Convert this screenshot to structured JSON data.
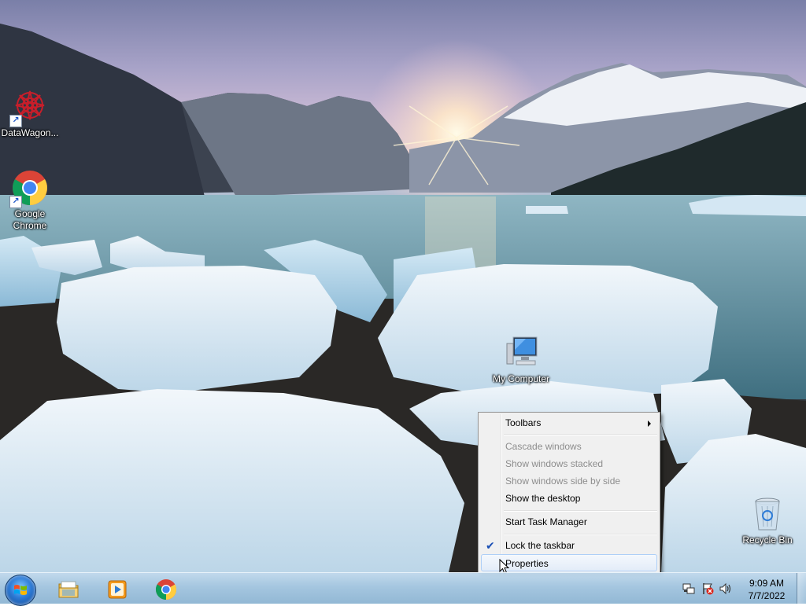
{
  "desktop": {
    "icons": [
      {
        "label": "DataWagon...",
        "icon": "datawagon-icon"
      },
      {
        "label": "Google Chrome",
        "icon": "chrome-icon"
      },
      {
        "label": "My Computer",
        "icon": "computer-icon"
      },
      {
        "label": "Recycle Bin",
        "icon": "recycle-bin-icon"
      }
    ]
  },
  "context_menu": {
    "items": [
      {
        "label": "Toolbars",
        "enabled": true,
        "submenu": true
      },
      {
        "label": "Cascade windows",
        "enabled": false
      },
      {
        "label": "Show windows stacked",
        "enabled": false
      },
      {
        "label": "Show windows side by side",
        "enabled": false
      },
      {
        "label": "Show the desktop",
        "enabled": true
      },
      {
        "label": "Start Task Manager",
        "enabled": true
      },
      {
        "label": "Lock the taskbar",
        "enabled": true,
        "checked": true
      },
      {
        "label": "Properties",
        "enabled": true,
        "highlighted": true
      }
    ]
  },
  "taskbar": {
    "pinned": [
      {
        "name": "windows-explorer",
        "icon": "folder-icon"
      },
      {
        "name": "windows-media-player",
        "icon": "media-player-icon"
      },
      {
        "name": "google-chrome",
        "icon": "chrome-icon"
      }
    ],
    "tray": {
      "icons": [
        "network-icon",
        "action-center-icon",
        "volume-icon"
      ],
      "time": "9:09 AM",
      "date": "7/7/2022"
    }
  },
  "colors": {
    "menu_bg": "#f0f0f0",
    "menu_border": "#979797",
    "menu_disabled_text": "#8d8d8d",
    "menu_highlight_border": "#aecff7",
    "taskbar_tint": "#a0c3de",
    "check_mark": "#1a4fb5"
  }
}
